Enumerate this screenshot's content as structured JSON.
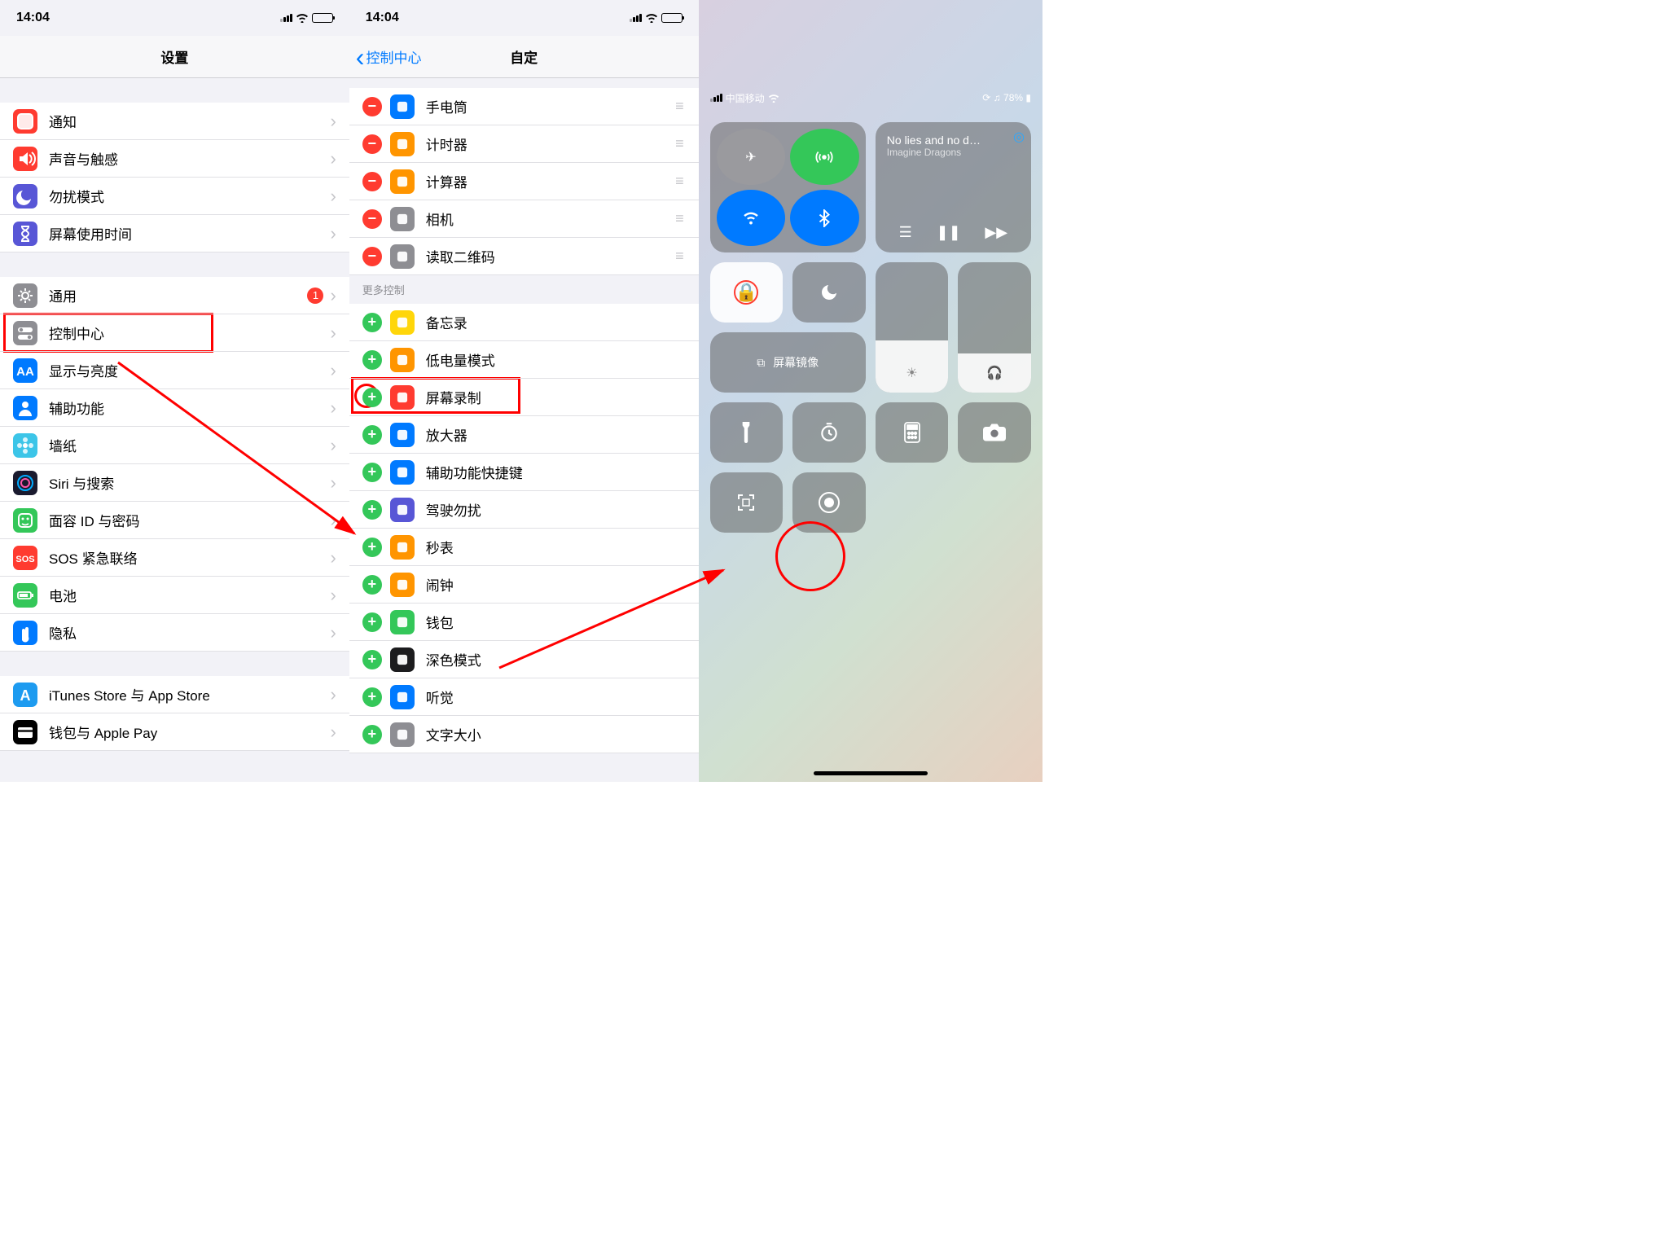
{
  "s1": {
    "time": "14:04",
    "title": "设置",
    "rows1": [
      {
        "label": "通知",
        "color": "#ff3b30",
        "icon": "square"
      },
      {
        "label": "声音与触感",
        "color": "#ff3b30",
        "icon": "speaker"
      },
      {
        "label": "勿扰模式",
        "color": "#5856d6",
        "icon": "moon"
      },
      {
        "label": "屏幕使用时间",
        "color": "#5856d6",
        "icon": "hourglass"
      }
    ],
    "rows2": [
      {
        "label": "通用",
        "color": "#8e8e93",
        "icon": "gear",
        "badge": "1"
      },
      {
        "label": "控制中心",
        "color": "#8e8e93",
        "icon": "toggles"
      },
      {
        "label": "显示与亮度",
        "color": "#007aff",
        "icon": "AA"
      },
      {
        "label": "辅助功能",
        "color": "#007aff",
        "icon": "person"
      },
      {
        "label": "墙纸",
        "color": "#3cc5e8",
        "icon": "flower"
      },
      {
        "label": "Siri 与搜索",
        "color": "#1a1a2e",
        "icon": "siri"
      },
      {
        "label": "面容 ID 与密码",
        "color": "#34c759",
        "icon": "face"
      },
      {
        "label": "SOS 紧急联络",
        "color": "#ff3b30",
        "icon": "SOS"
      },
      {
        "label": "电池",
        "color": "#34c759",
        "icon": "battery"
      },
      {
        "label": "隐私",
        "color": "#007aff",
        "icon": "hand"
      }
    ],
    "rows3": [
      {
        "label": "iTunes Store 与 App Store",
        "color": "#1d9bf0",
        "icon": "A"
      },
      {
        "label": "钱包与 Apple Pay",
        "color": "#000",
        "icon": "wallet"
      }
    ]
  },
  "s2": {
    "time": "14:04",
    "back": "控制中心",
    "title": "自定",
    "included": [
      {
        "label": "手电筒",
        "color": "#007aff",
        "dark": true
      },
      {
        "label": "计时器",
        "color": "#ff9500"
      },
      {
        "label": "计算器",
        "color": "#ff9500"
      },
      {
        "label": "相机",
        "color": "#8e8e93"
      },
      {
        "label": "读取二维码",
        "color": "#8e8e93"
      }
    ],
    "more_header": "更多控制",
    "more": [
      {
        "label": "备忘录",
        "color": "#ffd60a"
      },
      {
        "label": "低电量模式",
        "color": "#ff9500"
      },
      {
        "label": "屏幕录制",
        "color": "#ff3b30"
      },
      {
        "label": "放大器",
        "color": "#007aff"
      },
      {
        "label": "辅助功能快捷键",
        "color": "#007aff"
      },
      {
        "label": "驾驶勿扰",
        "color": "#5856d6"
      },
      {
        "label": "秒表",
        "color": "#ff9500"
      },
      {
        "label": "闹钟",
        "color": "#ff9500"
      },
      {
        "label": "钱包",
        "color": "#34c759"
      },
      {
        "label": "深色模式",
        "color": "#1c1c1e"
      },
      {
        "label": "听觉",
        "color": "#007aff"
      },
      {
        "label": "文字大小",
        "color": "#8e8e93"
      }
    ]
  },
  "s3": {
    "carrier": "中国移动",
    "battery": "78%",
    "song": "No lies and no d…",
    "artist": "Imagine Dragons",
    "mirror": "屏幕镜像"
  }
}
